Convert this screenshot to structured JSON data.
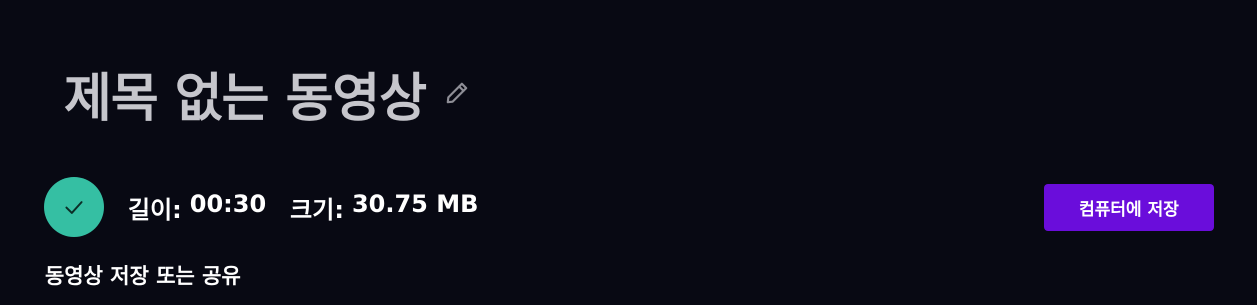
{
  "video": {
    "title": "제목 없는 동영상",
    "edit_icon": "pencil-icon",
    "status_icon": "check-icon",
    "duration_label": "길이:",
    "duration_value": "00:30",
    "size_label": "크기:",
    "size_value": "30.75 MB"
  },
  "actions": {
    "save_label": "컴퓨터에 저장"
  },
  "section": {
    "share_heading": "동영상 저장 또는 공유"
  },
  "colors": {
    "background": "#080913",
    "accent_button": "#6a0ddb",
    "success": "#35bfa3",
    "title_text": "#c6c6cc"
  }
}
